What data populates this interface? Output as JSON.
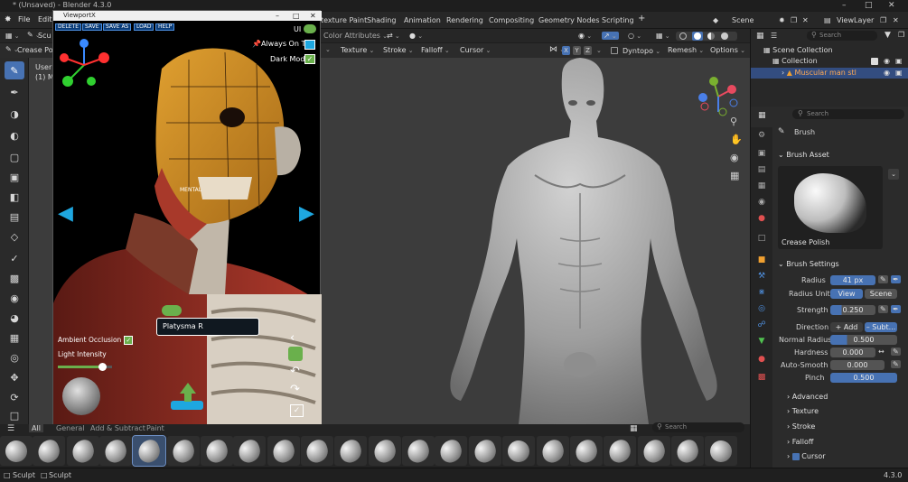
{
  "window": {
    "title": "* (Unsaved) - Blender 4.3.0"
  },
  "menu": {
    "file": "File",
    "edit": "Edit"
  },
  "workspaces": [
    "texture Paint",
    "Shading",
    "Animation",
    "Rendering",
    "Compositing",
    "Geometry Nodes",
    "Scripting"
  ],
  "scene": {
    "label": "Scene",
    "viewlayer": "ViewLayer"
  },
  "header": {
    "sculpt_mode": "Scu",
    "color_attributes": "Color Attributes"
  },
  "toolheader": {
    "brush_name": "Crease Pol",
    "texture": "Texture",
    "stroke": "Stroke",
    "falloff": "Falloff",
    "cursor": "Cursor",
    "x": "X",
    "y": "Y",
    "z": "Z",
    "dyntopo": "Dyntopo",
    "remesh": "Remesh",
    "options": "Options"
  },
  "viewport_info": {
    "line1": "User",
    "line2": "(1) M"
  },
  "outliner": {
    "search_placeholder": "Search",
    "scene_collection": "Scene Collection",
    "collection": "Collection",
    "object": "Muscular man stl"
  },
  "properties": {
    "search_placeholder": "Search",
    "context": "Brush",
    "brush_asset_header": "Brush Asset",
    "brush_asset_name": "Crease Polish",
    "brush_settings_header": "Brush Settings",
    "radius_label": "Radius",
    "radius_value": "41 px",
    "radius_unit_label": "Radius Unit",
    "radius_unit_view": "View",
    "radius_unit_scene": "Scene",
    "strength_label": "Strength",
    "strength_value": "0.250",
    "direction_label": "Direction",
    "direction_add": "Add",
    "direction_subtract": "Subt...",
    "normal_radius_label": "Normal Radius",
    "normal_radius_value": "0.500",
    "hardness_label": "Hardness",
    "hardness_value": "0.000",
    "auto_smooth_label": "Auto-Smooth",
    "auto_smooth_value": "0.000",
    "pinch_label": "Pinch",
    "pinch_value": "0.500",
    "advanced": "Advanced",
    "texture": "Texture",
    "stroke": "Stroke",
    "falloff": "Falloff",
    "cursor": "Cursor"
  },
  "asset_shelf": {
    "tab_all": "All",
    "tab_general": "General",
    "tab_add_subtract": "Add & Subtract",
    "tab_paint": "Paint",
    "search_placeholder": "Search"
  },
  "status": {
    "left1": "Sculpt",
    "left2": "Sculpt",
    "version": "4.3.0"
  },
  "viewportx": {
    "title": "ViewportX",
    "buttons": [
      "DELETE",
      "SAVE",
      "SAVE AS",
      "LOAD",
      "HELP"
    ],
    "ui_label": "UI",
    "always_on_top": "Always On Top",
    "dark_mode": "Dark Mode",
    "label_platysma": "Platysma R",
    "label_mental": "MENTAL",
    "ambient_occlusion": "Ambient Occlusion",
    "light_intensity": "Light Intensity",
    "light_intensity_level": 0.82
  },
  "colors": {
    "accent": "#4772b3",
    "bg": "#1d1d1d",
    "panel": "#2b2b2b",
    "viewport": "#3c3c3c",
    "vx_blue": "#1ea7e0",
    "vx_green": "#6ab04c"
  }
}
